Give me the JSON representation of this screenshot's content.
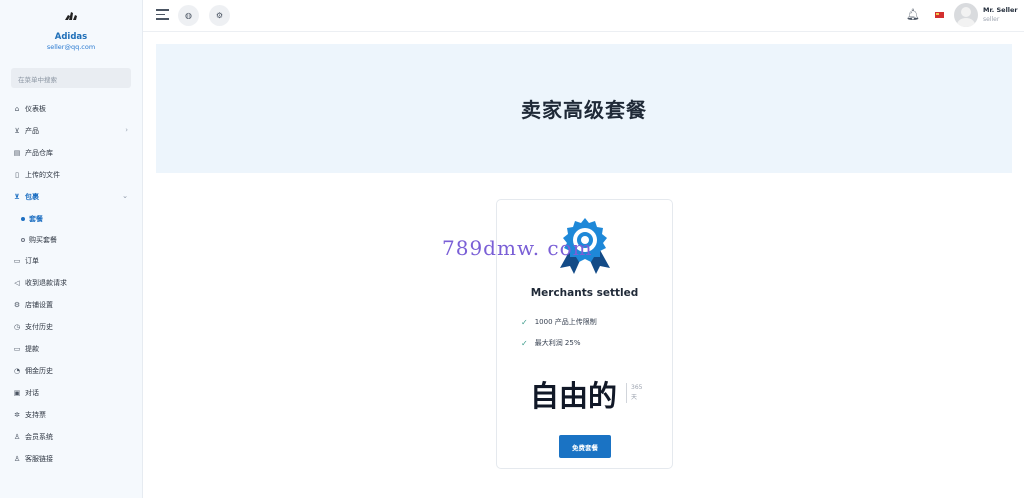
{
  "sidebar": {
    "shop_name": "Adidas",
    "shop_email": "seller@qq.com",
    "search_placeholder": "在菜单中搜索",
    "items": [
      {
        "label": "仪表板",
        "icon": "home-icon"
      },
      {
        "label": "产品",
        "icon": "cart-icon"
      },
      {
        "label": "产品仓库",
        "icon": "warehouse-icon"
      },
      {
        "label": "上传的文件",
        "icon": "file-icon"
      },
      {
        "label": "包裹",
        "icon": "package-icon"
      },
      {
        "label": "订单",
        "icon": "orders-icon"
      },
      {
        "label": "收到退款请求",
        "icon": "refund-icon"
      },
      {
        "label": "店铺设置",
        "icon": "gear-icon"
      },
      {
        "label": "支付历史",
        "icon": "history-icon"
      },
      {
        "label": "提款",
        "icon": "withdraw-icon"
      },
      {
        "label": "佣金历史",
        "icon": "commission-icon"
      },
      {
        "label": "对话",
        "icon": "chat-icon"
      },
      {
        "label": "支持票",
        "icon": "support-icon"
      },
      {
        "label": "会员系统",
        "icon": "member-icon"
      },
      {
        "label": "客服链接",
        "icon": "link-icon"
      }
    ],
    "sub_items": [
      {
        "label": "套餐"
      },
      {
        "label": "购买套餐"
      }
    ]
  },
  "topbar": {
    "user_name": "Mr. Seller",
    "user_role": "seller"
  },
  "banner": {
    "title": "卖家高级套餐"
  },
  "package": {
    "name": "Merchants settled",
    "features": [
      "1000 产品上传限制",
      "最大利润 25%"
    ],
    "price": "自由的",
    "duration_value": "365",
    "duration_unit": "天",
    "button_label": "免费套餐"
  },
  "watermark": "789dmw. com",
  "colors": {
    "accent": "#1a73c4",
    "banner_bg": "#edf5fc",
    "sidebar_bg": "#f5f9fd"
  }
}
